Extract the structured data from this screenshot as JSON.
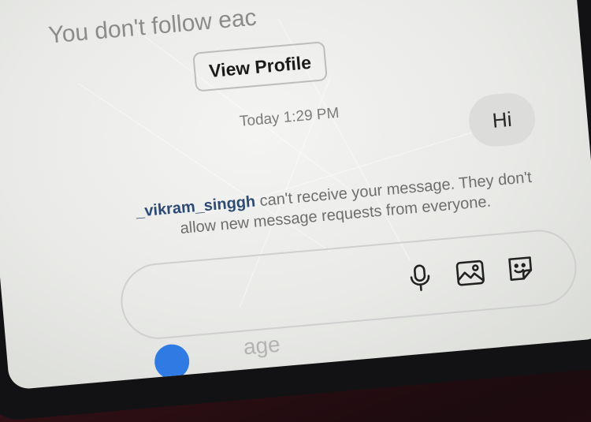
{
  "banner": {
    "follow_text": "You don't follow eac"
  },
  "profile": {
    "view_profile_label": "View Profile"
  },
  "thread": {
    "timestamp": "Today 1:29 PM",
    "sent_message": "Hi"
  },
  "error": {
    "username": "_vikram_singgh",
    "message": " can't receive your message. They don't allow new message requests from everyone."
  },
  "composer": {
    "placeholder_visible": "age",
    "icons": [
      "microphone-icon",
      "gallery-icon",
      "sticker-icon"
    ]
  },
  "colors": {
    "username_link": "#2c4a73",
    "bubble_bg": "#dcddda",
    "screen_bg": "#f0f1ef",
    "send_accent": "#2f7be3"
  }
}
